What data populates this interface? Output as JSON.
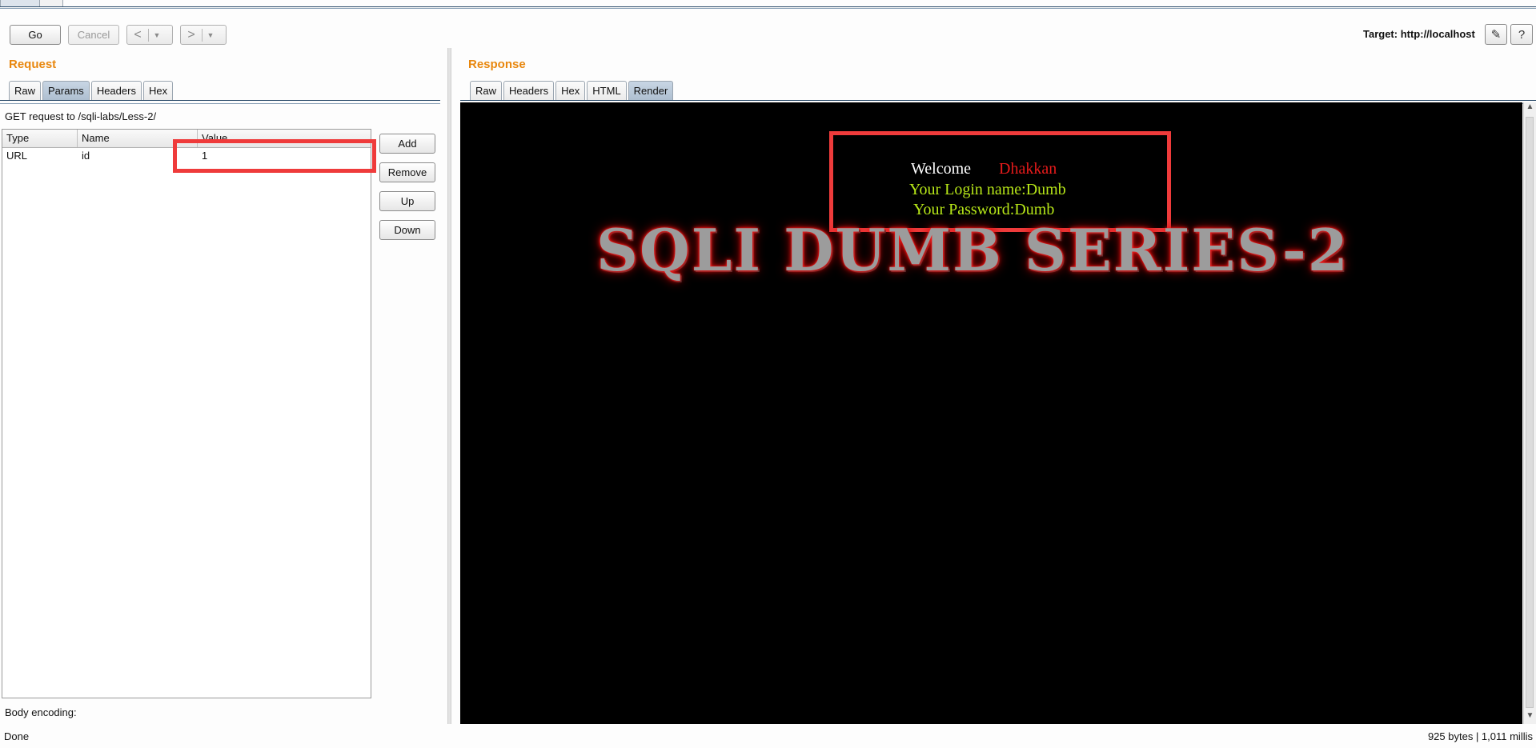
{
  "toolbar": {
    "go_label": "Go",
    "cancel_label": "Cancel",
    "back_arrow": "<",
    "forward_arrow": ">",
    "dropdown_glyph": "▼",
    "target_label": "Target: http://localhost",
    "edit_icon_glyph": "✎",
    "help_icon_glyph": "?"
  },
  "request": {
    "title": "Request",
    "tabs": [
      "Raw",
      "Params",
      "Headers",
      "Hex"
    ],
    "active_tab": "Params",
    "info": "GET request to /sqli-labs/Less-2/",
    "columns": [
      "Type",
      "Name",
      "Value"
    ],
    "rows": [
      {
        "type": "URL",
        "name": "id",
        "value": "1"
      }
    ],
    "buttons": [
      "Add",
      "Remove",
      "Up",
      "Down"
    ],
    "body_encoding_label": "Body encoding:"
  },
  "response": {
    "title": "Response",
    "tabs": [
      "Raw",
      "Headers",
      "Hex",
      "HTML",
      "Render"
    ],
    "active_tab": "Render",
    "render": {
      "welcome": "Welcome",
      "user": "Dhakkan",
      "login_name": "Your Login name:Dumb",
      "password": "Your Password:Dumb",
      "banner": "SQLI DUMB SERIES-2"
    }
  },
  "status": {
    "left": "Done",
    "right": "925 bytes | 1,011 millis"
  },
  "colors": {
    "accent_orange": "#e8870e",
    "highlight_red": "#ef3b3b",
    "render_green": "#b8e818",
    "render_red": "#e81b1b"
  }
}
